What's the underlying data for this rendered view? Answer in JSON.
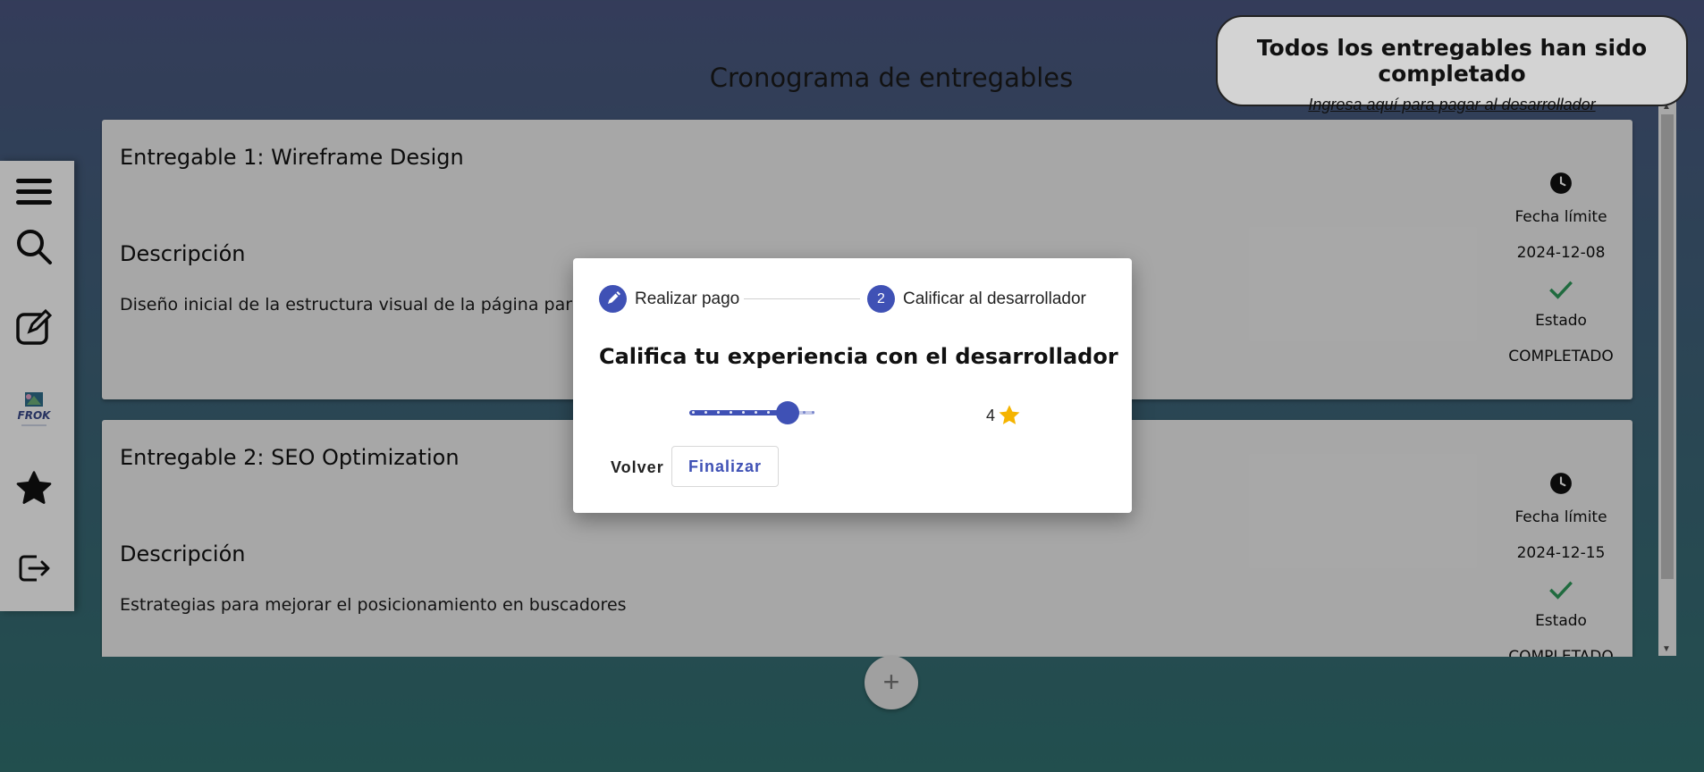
{
  "page": {
    "title": "Cronograma de entregables"
  },
  "deliverables": [
    {
      "title": "Entregable 1: Wireframe Design",
      "desc_label": "Descripción",
      "desc": "Diseño inicial de la estructura visual de la página para ga",
      "deadline_label": "Fecha límite",
      "deadline": "2024-12-08",
      "status_label": "Estado",
      "status": "COMPLETADO"
    },
    {
      "title": "Entregable 2: SEO Optimization",
      "desc_label": "Descripción",
      "desc": "Estrategias para mejorar el posicionamiento en buscadores",
      "deadline_label": "Fecha límite",
      "deadline": "2024-12-15",
      "status_label": "Estado",
      "status": "COMPLETADO"
    }
  ],
  "notice": {
    "title": "Todos los entregables han sido completado",
    "link": "Ingresa aquí para pagar al desarrollador"
  },
  "sidebar": {
    "icons": [
      "menu-icon",
      "search-icon",
      "edit-icon",
      "logo",
      "star-icon",
      "logout-icon"
    ],
    "logo_text": "FROK"
  },
  "dialog": {
    "steps": [
      {
        "label": "Realizar pago",
        "state": "completed"
      },
      {
        "number": "2",
        "label": "Calificar al desarrollador",
        "state": "active"
      }
    ],
    "heading": "Califica tu experiencia con el desarrollador",
    "rating": {
      "value": "4",
      "min": 0,
      "max": 5,
      "star_color": "#f5b400"
    },
    "back_label": "Volver",
    "finish_label": "Finalizar"
  },
  "add_button": "+",
  "colors": {
    "accent": "#3f51b5",
    "check": "#2e9a5b"
  }
}
